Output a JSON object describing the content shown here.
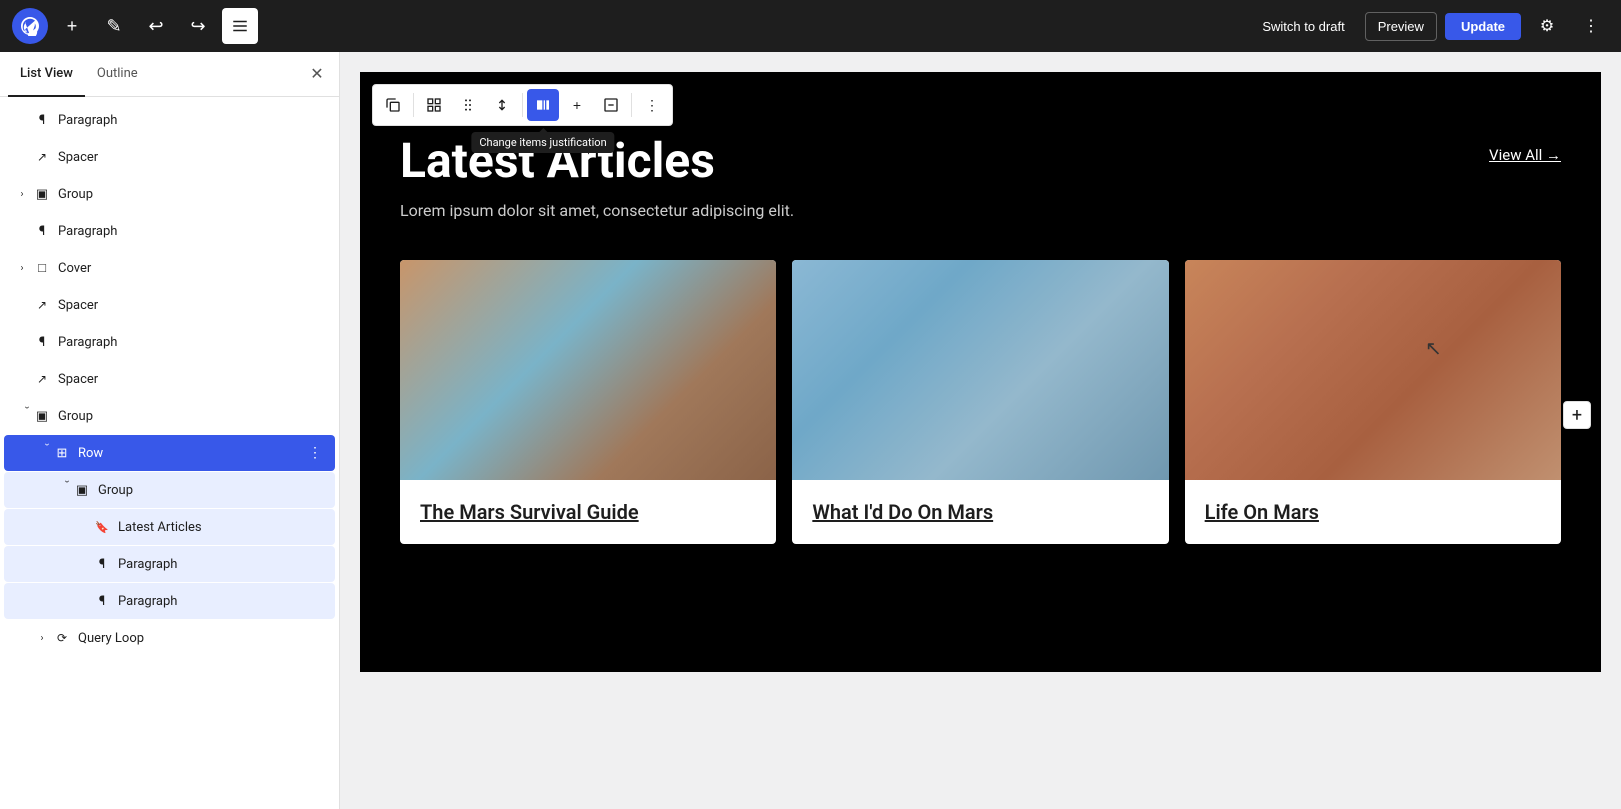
{
  "topbar": {
    "wp_logo_alt": "WordPress",
    "add_btn_label": "+",
    "edit_btn_label": "✎",
    "undo_btn_label": "↩",
    "redo_btn_label": "↪",
    "list_view_btn_label": "☰",
    "switch_draft_label": "Switch to draft",
    "preview_label": "Preview",
    "update_label": "Update",
    "settings_icon": "⚙",
    "more_icon": "⋮"
  },
  "sidebar": {
    "tab_list_view": "List View",
    "tab_outline": "Outline",
    "close_icon": "✕",
    "items": [
      {
        "id": "paragraph-1",
        "label": "Paragraph",
        "icon": "¶",
        "indent": 0,
        "expandable": false,
        "state": "normal"
      },
      {
        "id": "spacer-1",
        "label": "Spacer",
        "icon": "↗",
        "indent": 0,
        "expandable": false,
        "state": "normal"
      },
      {
        "id": "group-1",
        "label": "Group",
        "icon": "▣",
        "indent": 0,
        "expandable": true,
        "expanded": false,
        "state": "normal"
      },
      {
        "id": "paragraph-2",
        "label": "Paragraph",
        "icon": "¶",
        "indent": 0,
        "expandable": false,
        "state": "normal"
      },
      {
        "id": "cover-1",
        "label": "Cover",
        "icon": "□",
        "indent": 0,
        "expandable": true,
        "expanded": false,
        "state": "normal"
      },
      {
        "id": "spacer-2",
        "label": "Spacer",
        "icon": "↗",
        "indent": 0,
        "expandable": false,
        "state": "normal"
      },
      {
        "id": "paragraph-3",
        "label": "Paragraph",
        "icon": "¶",
        "indent": 0,
        "expandable": false,
        "state": "normal"
      },
      {
        "id": "spacer-3",
        "label": "Spacer",
        "icon": "↗",
        "indent": 0,
        "expandable": false,
        "state": "normal"
      },
      {
        "id": "group-2",
        "label": "Group",
        "icon": "▣",
        "indent": 0,
        "expandable": true,
        "expanded": true,
        "state": "normal"
      },
      {
        "id": "row-1",
        "label": "Row",
        "icon": "⊞",
        "indent": 1,
        "expandable": true,
        "expanded": true,
        "state": "selected"
      },
      {
        "id": "group-3",
        "label": "Group",
        "icon": "▣",
        "indent": 2,
        "expandable": true,
        "expanded": true,
        "state": "child"
      },
      {
        "id": "latest-articles",
        "label": "Latest Articles",
        "icon": "🔖",
        "indent": 3,
        "expandable": false,
        "state": "child"
      },
      {
        "id": "paragraph-4",
        "label": "Paragraph",
        "icon": "¶",
        "indent": 3,
        "expandable": false,
        "state": "child"
      },
      {
        "id": "paragraph-5",
        "label": "Paragraph",
        "icon": "¶",
        "indent": 3,
        "expandable": false,
        "state": "child"
      },
      {
        "id": "query-loop",
        "label": "Query Loop",
        "icon": "⟳",
        "indent": 1,
        "expandable": true,
        "expanded": false,
        "state": "normal"
      }
    ]
  },
  "toolbar": {
    "duplicate_icon": "⊡",
    "align_icon": "⊞",
    "drag_icon": "⠿",
    "move_icon": "▲▼",
    "justify_icon": "▐",
    "justify_tooltip": "Change items justification",
    "add_icon": "+",
    "more_icon": "⋮",
    "wrap_icon": "⊟"
  },
  "section": {
    "title": "Latest Articles",
    "description": "Lorem ipsum dolor sit amet, consectetur adipiscing elit.",
    "view_all": "View All →",
    "articles": [
      {
        "id": "article-1",
        "title": "The Mars Survival Guide",
        "img_class": "mars-img-1"
      },
      {
        "id": "article-2",
        "title": "What I'd Do On Mars",
        "img_class": "mars-img-2"
      },
      {
        "id": "article-3",
        "title": "Life On Mars",
        "img_class": "mars-img-3"
      }
    ]
  },
  "colors": {
    "accent": "#3858e9",
    "selected_bg": "#3858e9",
    "child_selected_bg": "#e8eeff",
    "canvas_bg": "#000000",
    "toolbar_active": "#3858e9"
  }
}
